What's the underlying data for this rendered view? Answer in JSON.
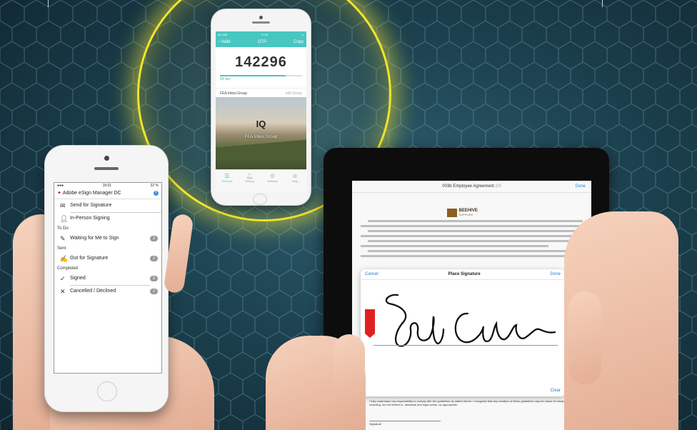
{
  "left_phone": {
    "status": {
      "time": "16:01",
      "battery": "22 %"
    },
    "nav_title": "Adobe eSign Manager DC",
    "items_top": [
      {
        "label": "Send for Signature",
        "icon": "envelope-icon"
      },
      {
        "label": "In-Person Signing",
        "icon": "person-icon"
      }
    ],
    "sections": {
      "todo": "To Do",
      "sent": "Sent",
      "completed": "Completed"
    },
    "waiting": {
      "label": "Waiting for Me to Sign",
      "count": "2"
    },
    "out": {
      "label": "Out for Signature",
      "count": "2"
    },
    "signed": {
      "label": "Signed",
      "count": "6"
    },
    "cancelled": {
      "label": "Cancelled / Declined",
      "count": "2"
    }
  },
  "otp_phone": {
    "status": {
      "carrier": "No SIM",
      "time": "17:44"
    },
    "nav": {
      "back": "Valid",
      "title": "OTP",
      "copy": "Copy"
    },
    "code": "142296",
    "timer": "24 sec",
    "timer_fraction": 0.8,
    "group": "FEA Intesi Group",
    "edit": "edit Group",
    "image_name": "FEA Intesi Group",
    "tabs": [
      {
        "label": "Services",
        "icon": "menu-icon",
        "active": true
      },
      {
        "label": "History",
        "icon": "bell-icon",
        "active": false
      },
      {
        "label": "Settings",
        "icon": "gear-icon",
        "active": false
      },
      {
        "label": "Help",
        "icon": "help-icon",
        "active": false
      }
    ]
  },
  "tablet": {
    "doc_title": "003b Employee Agreement",
    "doc_count": "2/3",
    "done": "Done",
    "brand": "BEEHIVE",
    "brand_sub": "SUPPLIES",
    "panel": {
      "cancel": "Cancel",
      "title": "Place Signature",
      "done": "Done",
      "clear": "Clear"
    },
    "bottom_text": "I fully understand my responsibility to comply with the guidelines as stated herein. I recognize that any violation of these guidelines may be cause for disciplinary action including, but not limited to, dismissal and legal action, as appropriate.",
    "signature_caption": "Signature"
  },
  "colors": {
    "accent": "#48c6c0",
    "glow": "#f2e52a",
    "link": "#2a7bd4",
    "badge": "#999999"
  }
}
